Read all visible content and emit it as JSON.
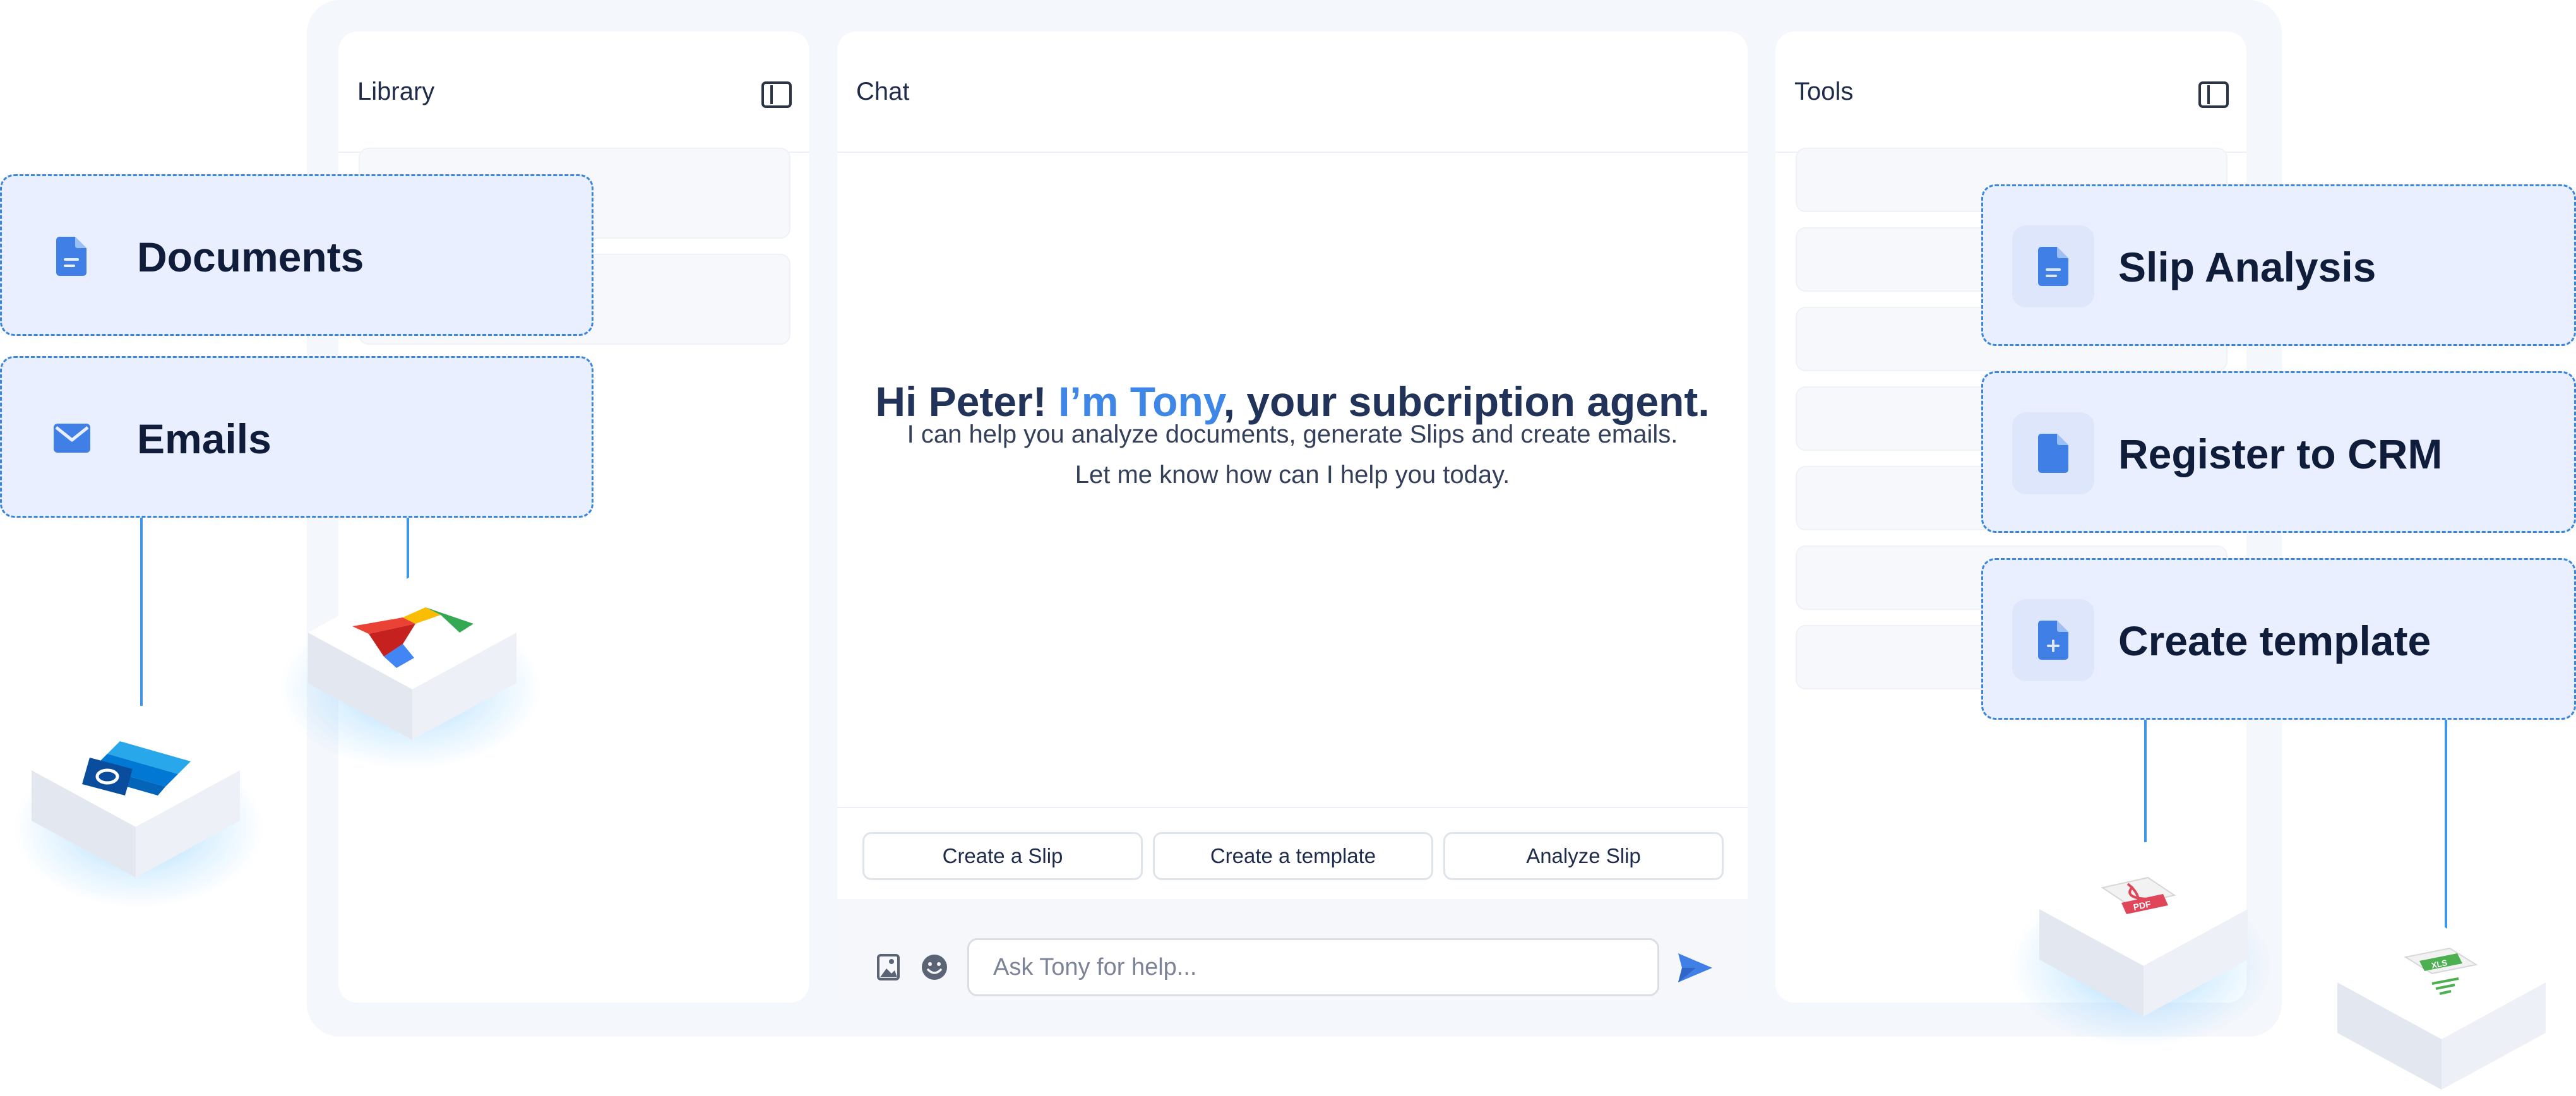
{
  "library": {
    "title": "Library"
  },
  "chat": {
    "title": "Chat",
    "greeting_pre": "Hi Peter! ",
    "greeting_name": "I’m Tony",
    "greeting_post": ", your subcription agent.",
    "subtitle_line1": "I can help you analyze documents, generate Slips and create emails.",
    "subtitle_line2": "Let me know how can I help you today.",
    "suggestions": [
      "Create a Slip",
      "Create a template",
      "Analyze Slip"
    ],
    "input_placeholder": "Ask Tony for help..."
  },
  "tools": {
    "title": "Tools"
  },
  "left_cards": [
    {
      "label": "Documents",
      "icon": "document-icon"
    },
    {
      "label": "Emails",
      "icon": "mail-icon"
    }
  ],
  "right_cards": [
    {
      "label": "Slip Analysis",
      "icon": "document-icon"
    },
    {
      "label": "Register to CRM",
      "icon": "document-icon"
    },
    {
      "label": "Create template",
      "icon": "document-add-icon"
    }
  ],
  "tiles": [
    {
      "icon": "outlook-icon"
    },
    {
      "icon": "gmail-icon"
    },
    {
      "icon": "pdf-icon",
      "label": "PDF"
    },
    {
      "icon": "xls-icon",
      "label": "XLS"
    }
  ],
  "colors": {
    "accent": "#3f87e6",
    "card_bg": "#e9efff",
    "card_border": "#3a86dc",
    "heading": "#22335a"
  }
}
